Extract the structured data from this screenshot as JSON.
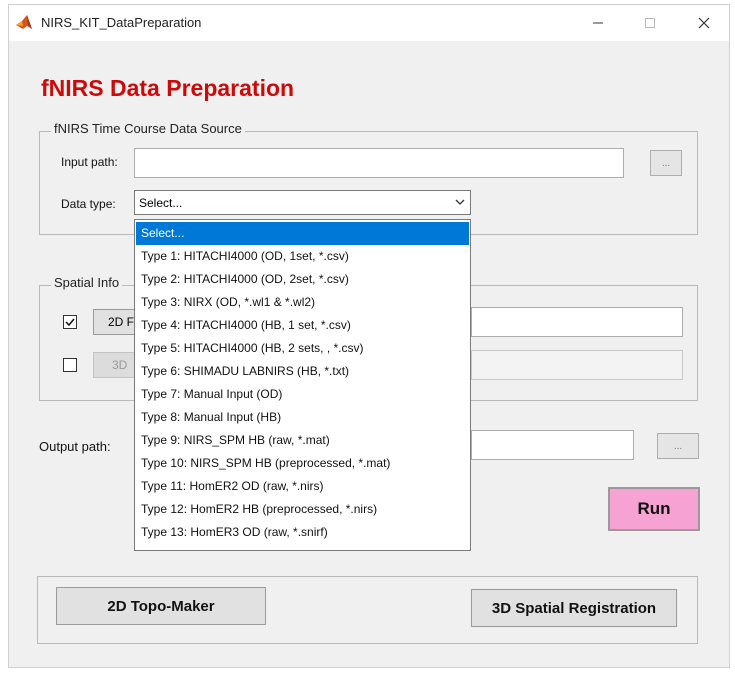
{
  "window": {
    "title": "NIRS_KIT_DataPreparation"
  },
  "heading": "fNIRS Data Preparation",
  "source_group": {
    "label": "fNIRS Time Course Data Source",
    "input_path_label": "Input path:",
    "input_path_value": "",
    "browse_label": "...",
    "data_type_label": "Data type:",
    "data_type_selected": "Select..."
  },
  "spatial_group": {
    "label": "Spatial Info",
    "btn_2d_label": "2D F",
    "btn_3d_label": "3D",
    "check_2d": true,
    "check_3d": false
  },
  "output": {
    "label": "Output path:",
    "browse_label": "..."
  },
  "run_label": "Run",
  "bottom": {
    "topo_label": "2D Topo-Maker",
    "spatial_label": "3D Spatial Registration"
  },
  "dropdown_options": [
    "Select...",
    "Type 1: HITACHI4000 (OD, 1set, *.csv)",
    "Type 2: HITACHI4000 (OD, 2set, *.csv)",
    "Type 3: NIRX (OD, *.wl1 & *.wl2)",
    "Type 4: HITACHI4000 (HB, 1 set, *.csv)",
    "Type 5: HITACHI4000 (HB, 2 sets, , *.csv)",
    "Type 6: SHIMADU LABNIRS (HB, *.txt)",
    "Type 7: Manual Input (OD)",
    "Type 8: Manual Input (HB)",
    "Type 9: NIRS_SPM HB (raw, *.mat)",
    "Type 10: NIRS_SPM HB (preprocessed, *.mat)",
    "Type 11: HomER2 OD (raw, *.nirs)",
    "Type 12: HomER2 HB (preprocessed, *.nirs)",
    "Type 13: HomER3 OD  (raw, *.snirf)"
  ],
  "colors": {
    "heading": "#cc0a0a",
    "run_button": "#f6a3d3",
    "highlight": "#0078d7"
  },
  "icons": {
    "app": "matlab-icon",
    "minimize": "minimize-icon",
    "maximize": "maximize-icon",
    "close": "close-icon",
    "dropdown": "chevron-down-icon",
    "check": "check-icon"
  }
}
